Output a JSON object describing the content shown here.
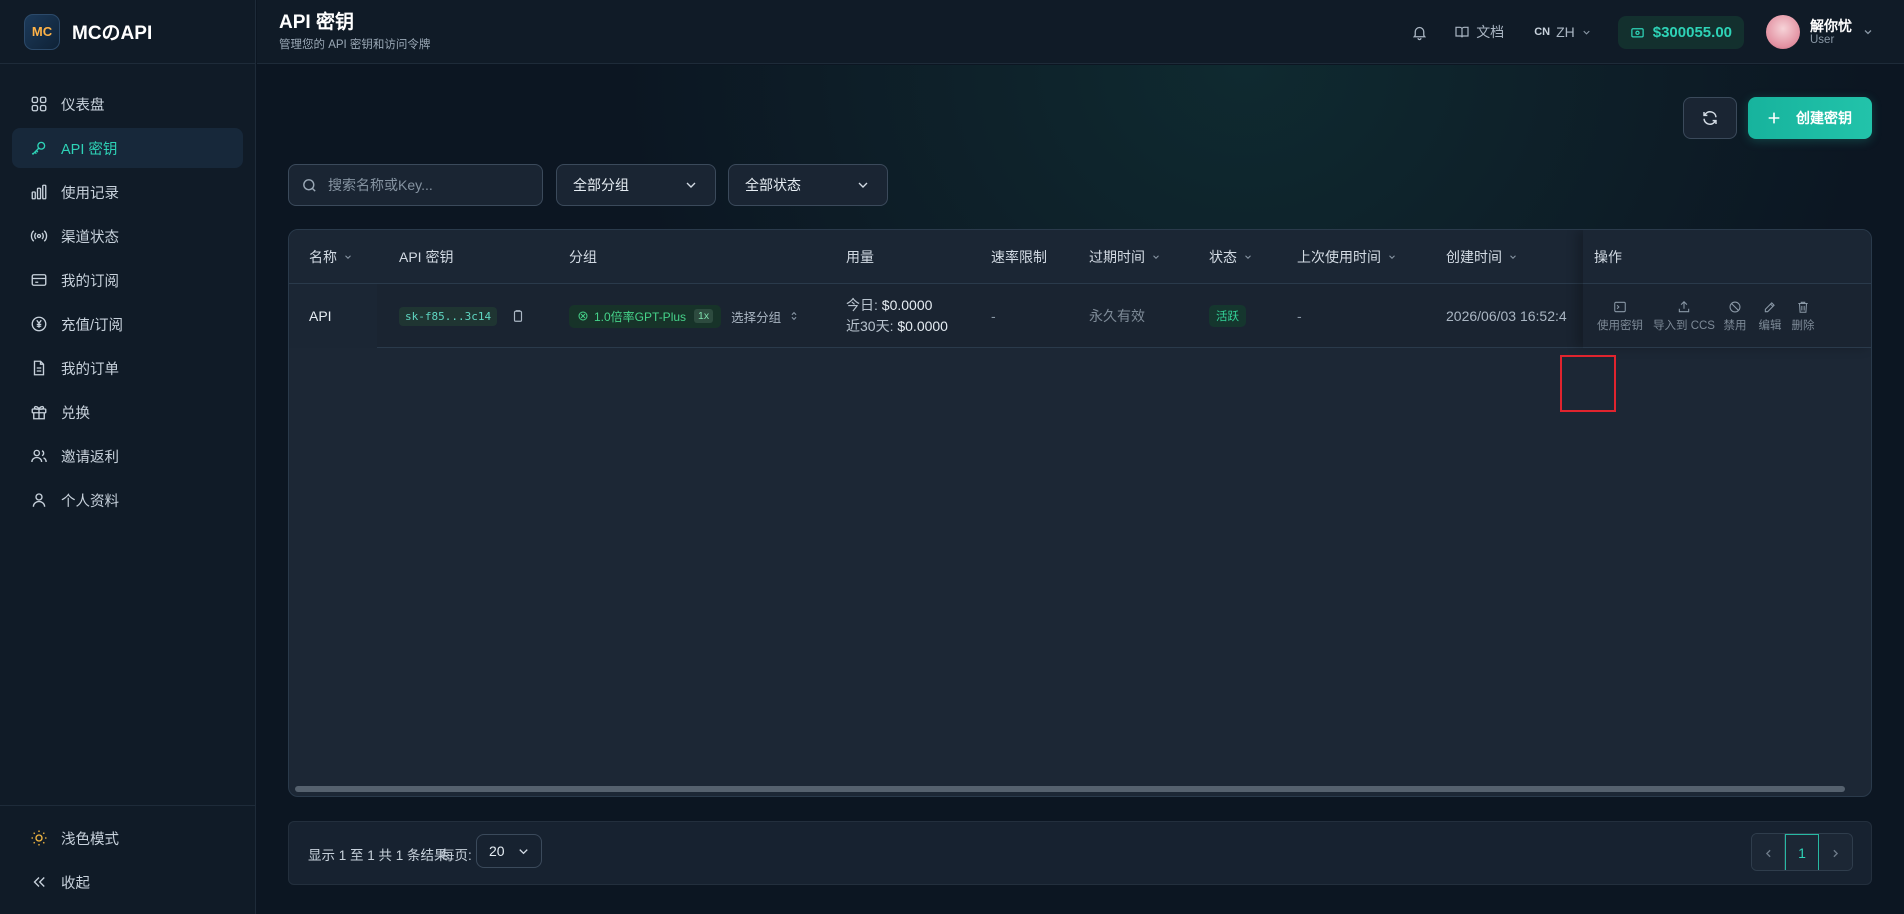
{
  "brand": {
    "name": "MCのAPI",
    "logo_text": "MC"
  },
  "sidebar": {
    "items": [
      {
        "label": "仪表盘",
        "icon": "dashboard-icon",
        "active": false
      },
      {
        "label": "API 密钥",
        "icon": "key-icon",
        "active": true
      },
      {
        "label": "使用记录",
        "icon": "bar-chart-icon",
        "active": false
      },
      {
        "label": "渠道状态",
        "icon": "broadcast-icon",
        "active": false
      },
      {
        "label": "我的订阅",
        "icon": "credit-card-icon",
        "active": false
      },
      {
        "label": "充值/订阅",
        "icon": "yuan-icon",
        "active": false
      },
      {
        "label": "我的订单",
        "icon": "document-icon",
        "active": false
      },
      {
        "label": "兑换",
        "icon": "gift-icon",
        "active": false
      },
      {
        "label": "邀请返利",
        "icon": "users-icon",
        "active": false
      },
      {
        "label": "个人资料",
        "icon": "user-icon",
        "active": false
      }
    ],
    "theme_toggle": "浅色模式",
    "collapse": "收起"
  },
  "header": {
    "title": "API 密钥",
    "subtitle": "管理您的 API 密钥和访问令牌",
    "docs": "文档",
    "lang_code": "CN",
    "lang": "ZH",
    "balance": "$300055.00",
    "user_name": "解你忧",
    "user_role": "User"
  },
  "toolbar": {
    "create_label": "创建密钥"
  },
  "filters": {
    "search_placeholder": "搜索名称或Key...",
    "group": "全部分组",
    "status": "全部状态"
  },
  "table": {
    "columns": [
      "名称",
      "API 密钥",
      "分组",
      "用量",
      "速率限制",
      "过期时间",
      "状态",
      "上次使用时间",
      "创建时间",
      "操作"
    ],
    "rows": [
      {
        "name": "API",
        "key": "sk-f85...3c14",
        "group": "1.0倍率GPT-Plus",
        "multiplier": "1x",
        "group_select": "选择分组",
        "usage_today_label": "今日:",
        "usage_today": "$0.0000",
        "usage_30d_label": "近30天:",
        "usage_30d": "$0.0000",
        "rate_limit": "-",
        "expires": "永久有效",
        "status": "活跃",
        "last_used": "-",
        "created": "2026/06/03 16:52:4",
        "actions": [
          "使用密钥",
          "导入到 CCS",
          "禁用",
          "编辑",
          "删除"
        ]
      }
    ]
  },
  "pagination": {
    "summary": "显示 1 至 1 共 1 条结果",
    "per_page_label": "每页:",
    "per_page": "20",
    "current_page": "1"
  },
  "colors": {
    "accent": "#2ed3b7",
    "background": "#0c1622",
    "highlight": "#e0242e"
  }
}
